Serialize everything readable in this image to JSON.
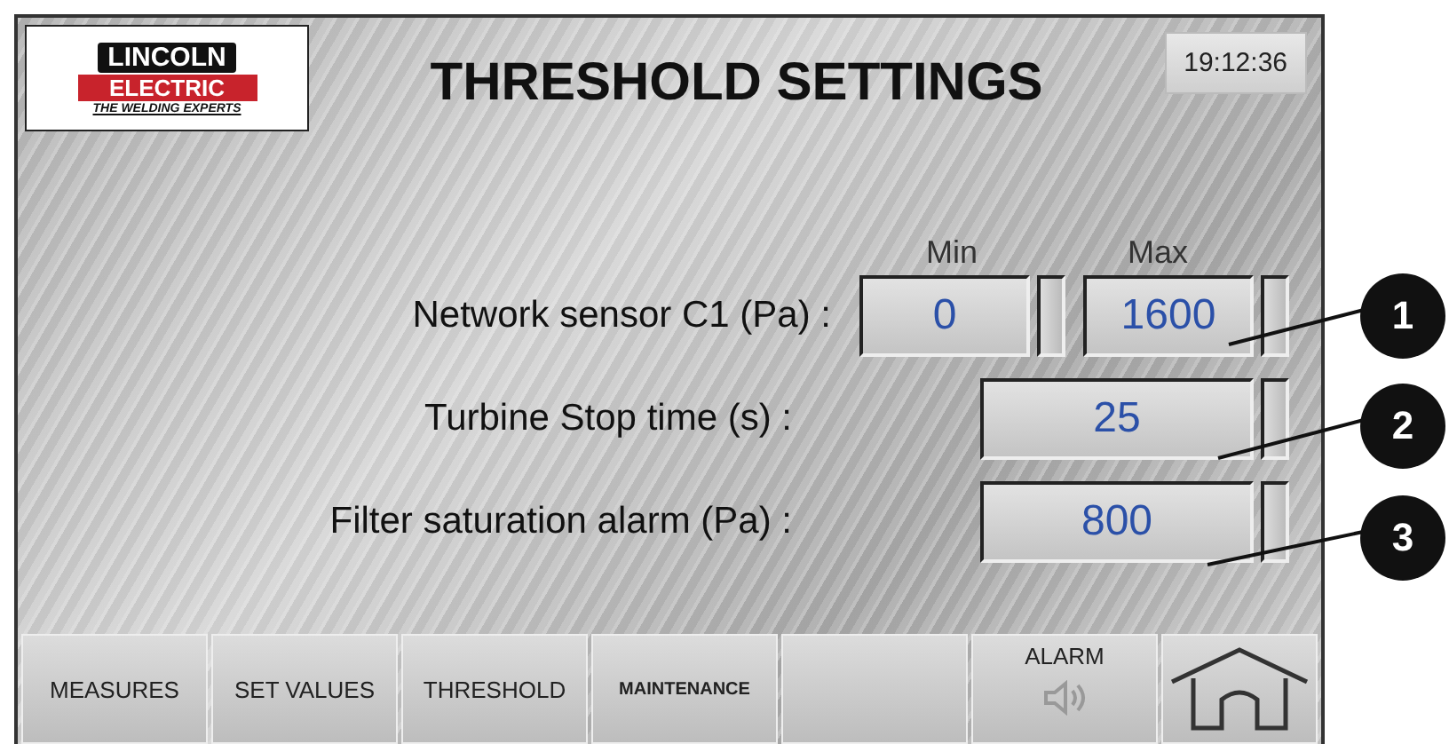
{
  "logo": {
    "line_1": "LINCOLN",
    "line_2": "ELECTRIC",
    "tagline": "THE WELDING EXPERTS"
  },
  "title": "THRESHOLD SETTINGS",
  "clock": "19:12:36",
  "columns": [
    "Min",
    "Max"
  ],
  "settings": [
    {
      "label": "Network sensor C1 (Pa) :",
      "values": [
        "0",
        "1600"
      ]
    },
    {
      "label": "Turbine Stop time (s) :",
      "values": [
        "25"
      ]
    },
    {
      "label": "Filter saturation alarm (Pa) :",
      "values": [
        "800"
      ]
    }
  ],
  "nav": [
    {
      "label": "MEASURES",
      "kind": "text"
    },
    {
      "label": "SET VALUES",
      "kind": "text"
    },
    {
      "label": "THRESHOLD",
      "kind": "text"
    },
    {
      "label": "MAINTENANCE",
      "kind": "small"
    },
    {
      "kind": "blank"
    },
    {
      "label": "ALARM",
      "kind": "alarm"
    },
    {
      "kind": "home"
    }
  ],
  "callouts": [
    "1",
    "2",
    "3"
  ]
}
